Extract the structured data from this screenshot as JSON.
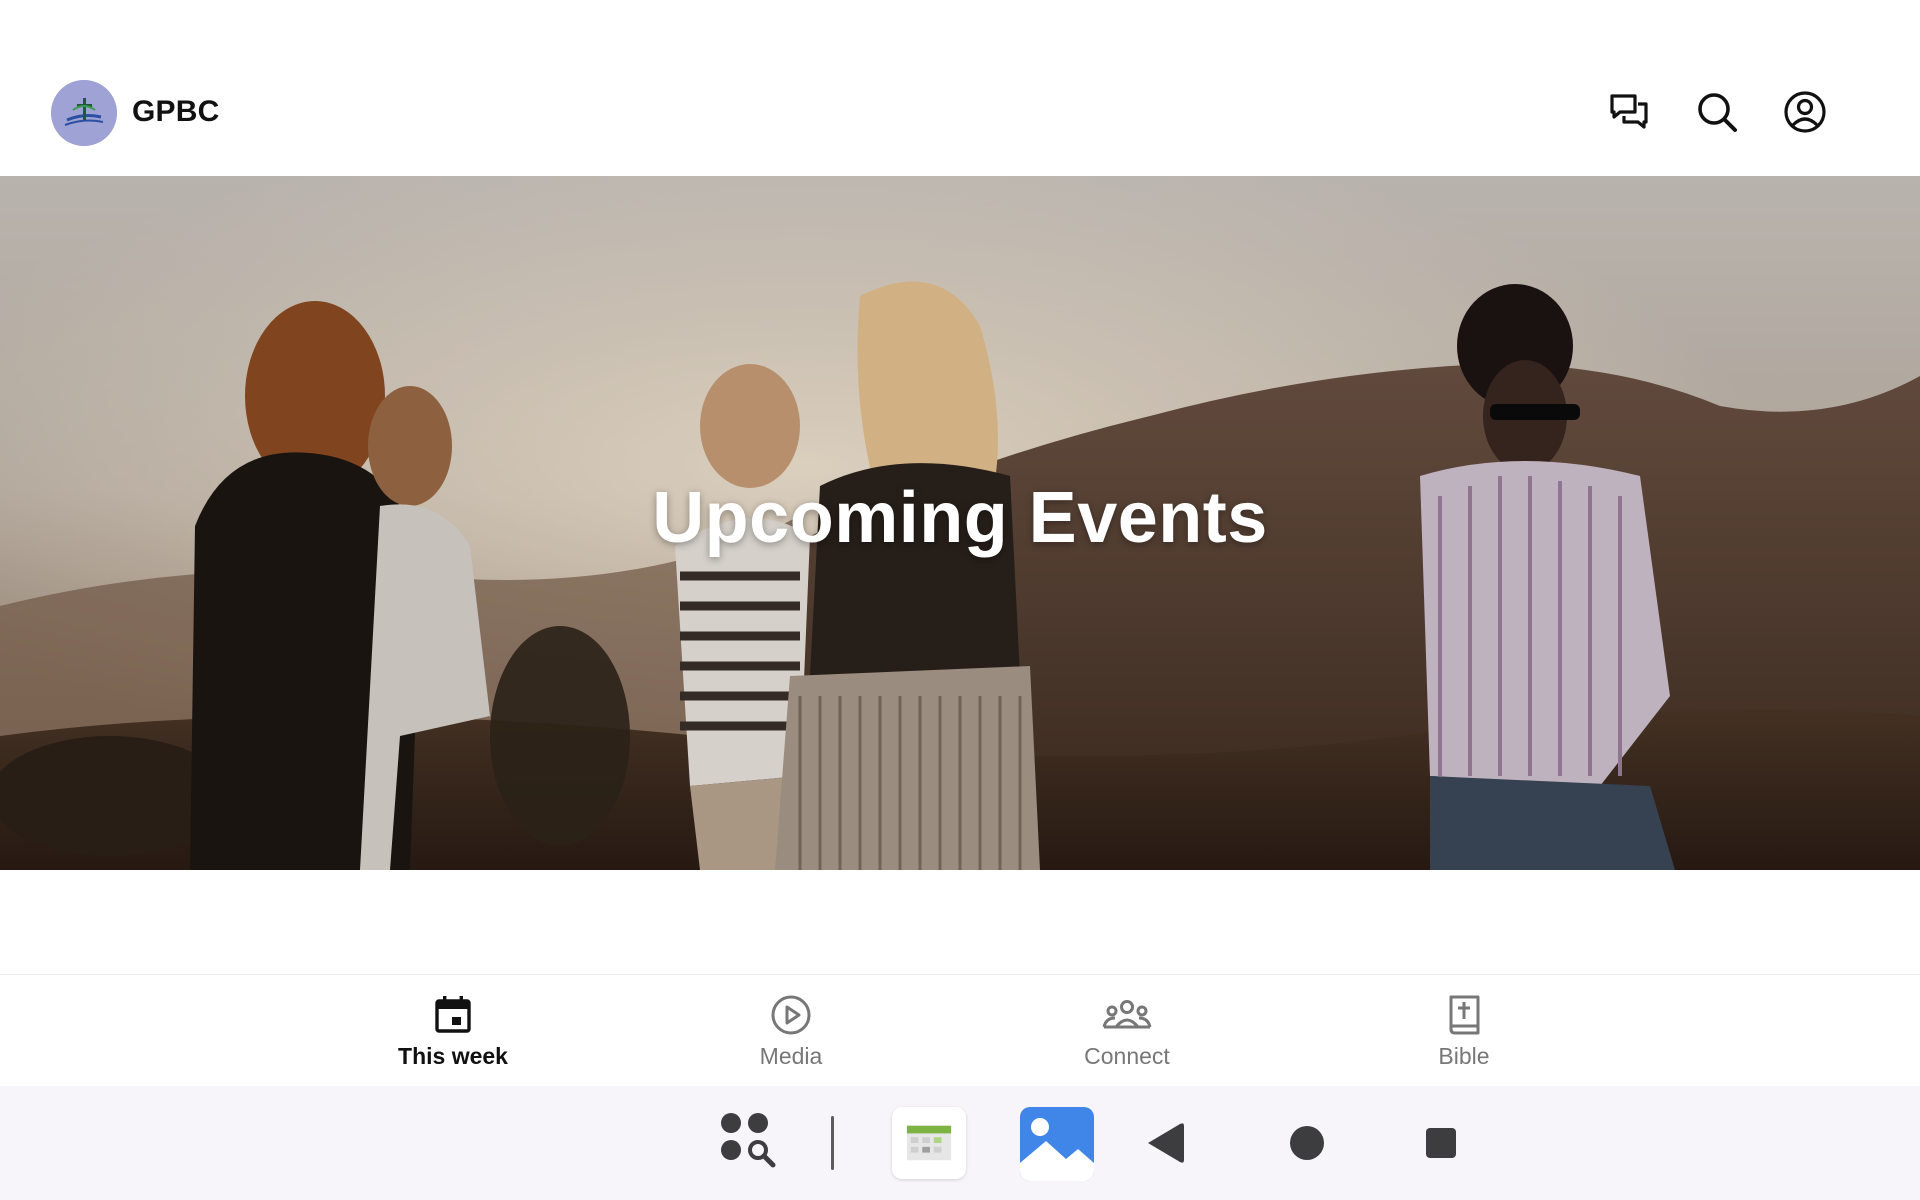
{
  "header": {
    "app_title": "GPBC",
    "logo_icon": "church-cross-logo",
    "actions": [
      {
        "name": "chat-icon"
      },
      {
        "name": "search-icon"
      },
      {
        "name": "profile-icon"
      }
    ]
  },
  "hero": {
    "title": "Upcoming Events"
  },
  "bottom_nav": {
    "items": [
      {
        "label": "This week",
        "icon": "calendar-icon",
        "active": true
      },
      {
        "label": "Media",
        "icon": "play-circle-icon",
        "active": false
      },
      {
        "label": "Connect",
        "icon": "groups-icon",
        "active": false
      },
      {
        "label": "Bible",
        "icon": "bible-icon",
        "active": false
      }
    ]
  },
  "system_bar": {
    "buttons": [
      "app-search-icon",
      "calendar-app-icon",
      "gallery-app-icon",
      "back-icon",
      "home-icon",
      "recents-icon"
    ]
  },
  "colors": {
    "logo_bg": "#9fa2d4",
    "active_text": "#111111",
    "inactive_text": "#777777",
    "system_bar_bg": "#f7f5f9"
  }
}
